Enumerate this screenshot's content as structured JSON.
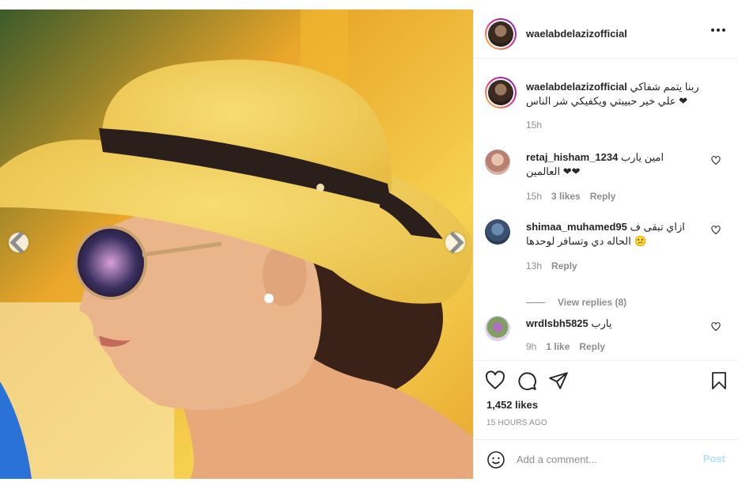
{
  "post": {
    "author": "waelabdelazizofficial",
    "caption_username": "waelabdelazizofficial",
    "caption_text": "ربنا يتمم شفاكي علي خير حبيبتي ويكفيكي شر الناس ❤",
    "caption_time": "15h"
  },
  "image": {
    "alt": "Woman wearing a straw hat with a black ribbon and mirrored sunglasses",
    "colors": {
      "hat": "#f0cf5a",
      "ribbon": "#2a1f1a",
      "skin": "#e8b58a",
      "hair": "#3a2218",
      "background": "#f4c238"
    }
  },
  "nav": {
    "prev_icon": "chevron-left-icon",
    "next_icon": "chevron-right-icon"
  },
  "comments": [
    {
      "username": "retaj_hisham_1234",
      "text": "امين يارب العالمين ❤❤",
      "time": "15h",
      "likes": "3 likes",
      "reply": "Reply"
    },
    {
      "username": "shimaa_muhamed95",
      "text": "ازاي تبقى ف الحاله دي وتسافر لوحدها 😕",
      "time": "13h",
      "reply": "Reply"
    },
    {
      "username": "wrdlsbh5825",
      "text": "يارب",
      "time": "9h",
      "likes": "1 like",
      "reply": "Reply"
    }
  ],
  "view_replies": "View replies (8)",
  "actions": {
    "likes": "1,452 likes",
    "time_ago": "15 HOURS AGO",
    "icons": [
      "heart-icon",
      "comment-icon",
      "share-icon",
      "bookmark-icon"
    ]
  },
  "add_comment": {
    "placeholder": "Add a comment...",
    "post_label": "Post",
    "emoji_icon": "smiley-icon"
  },
  "colors": {
    "text": "#262626",
    "muted": "#8e8e8e",
    "post_disabled": "#b2dffc",
    "border": "#efefef"
  }
}
